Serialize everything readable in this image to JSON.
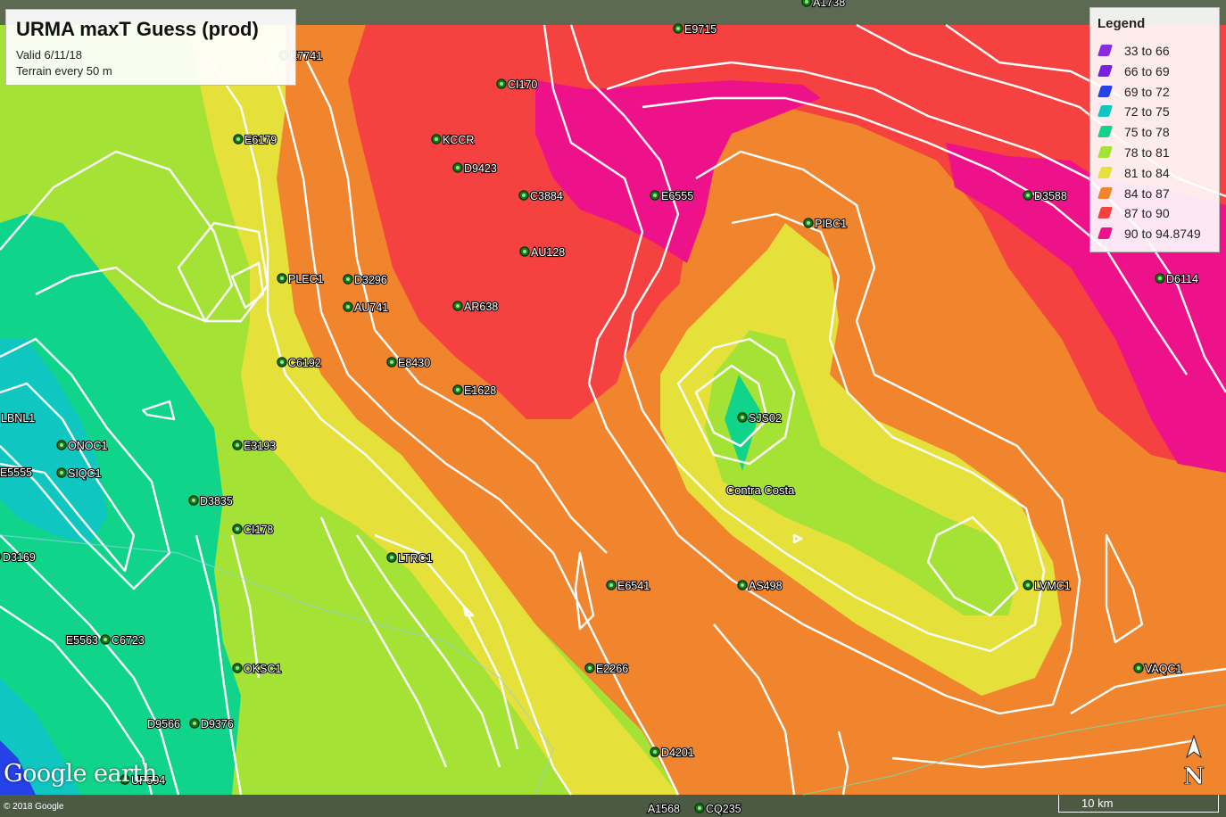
{
  "title": "URMA maxT Guess (prod)",
  "subtitle_lines": [
    "Valid 6/11/18",
    "Terrain every 50 m"
  ],
  "legend": {
    "title": "Legend",
    "items": [
      {
        "label": "33 to 66",
        "color": "#8a2be2"
      },
      {
        "label": "66 to 69",
        "color": "#7b1fe0"
      },
      {
        "label": "69 to 72",
        "color": "#2541e8"
      },
      {
        "label": "72 to 75",
        "color": "#0fc6c0"
      },
      {
        "label": "75 to 78",
        "color": "#10d48a"
      },
      {
        "label": "78 to 81",
        "color": "#a4e335"
      },
      {
        "label": "81 to 84",
        "color": "#e6e03a"
      },
      {
        "label": "84 to 87",
        "color": "#f0852d"
      },
      {
        "label": "87 to 90",
        "color": "#f5413f"
      },
      {
        "label": "90 to 94.8749",
        "color": "#ee128a"
      }
    ]
  },
  "stations": [
    "E9715",
    "CI170",
    "KCCR",
    "D9423",
    "C3884",
    "E6555",
    "E6179",
    "PIBC1",
    "D3588",
    "AU128",
    "D3296",
    "PLEC1",
    "AU741",
    "AR638",
    "D6114",
    "C6192",
    "E8430",
    "E1628",
    "SJS02",
    "LBNL1",
    "ONOC1",
    "E5555",
    "SIQC1",
    "E3193",
    "D3835",
    "CI178",
    "D3169",
    "LTRC1",
    "E6541",
    "AS498",
    "LVMC1",
    "E5563",
    "C6723",
    "OKSC1",
    "E2266",
    "VAQC1",
    "D9566",
    "D9376",
    "D4201",
    "UP594",
    "A1568",
    "CQ235",
    "A1738",
    "E7741"
  ],
  "place_label": "Contra Costa",
  "branding": {
    "logo": "Google earth",
    "copyright": "© 2018 Google"
  },
  "scale_bar": "10 km",
  "north_arrow": "N"
}
